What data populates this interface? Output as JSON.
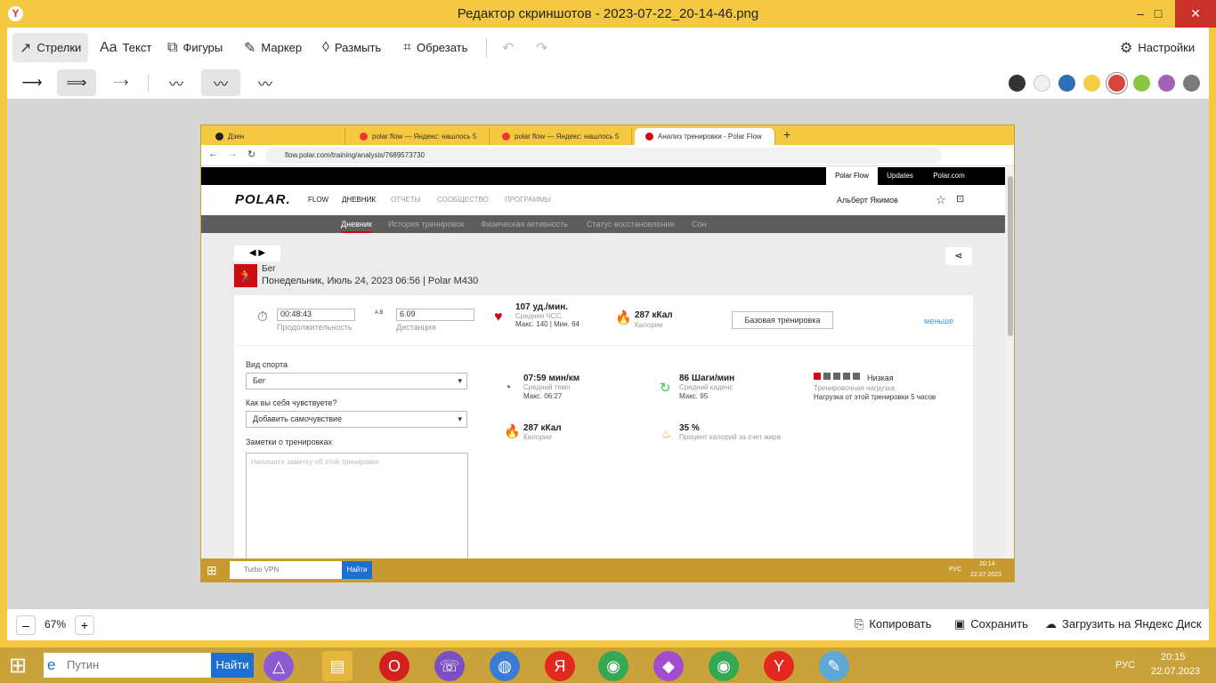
{
  "window": {
    "title": "Редактор скриншотов - 2023-07-22_20-14-46.png",
    "minimize": "–",
    "maximize": "□",
    "close": "✕"
  },
  "toolbar": {
    "arrows": "Стрелки",
    "text": "Текст",
    "shapes": "Фигуры",
    "marker": "Маркер",
    "blur": "Размыть",
    "crop": "Обрезать",
    "settings": "Настройки"
  },
  "colors": [
    "#333333",
    "#f0f0f0",
    "#2f6fb5",
    "#f5cc42",
    "#d9453b",
    "#8cc63f",
    "#a462b7",
    "#7a7a7a"
  ],
  "screenshot": {
    "tabs": [
      "Дзен",
      "polar flow — Яндекс: нашлось 5",
      "polar flow — Яндекс: нашлось 5",
      "Анализ тренировки - Polar Flow"
    ],
    "url": "flow.polar.com/training/analysis/7689573730",
    "top_links": [
      "Polar Flow",
      "Updates",
      "Polar.com"
    ],
    "logo": "POLAR.",
    "flow": "FLOW",
    "main_nav": [
      "ДНЕВНИК",
      "ОТЧЕТЫ",
      "СООБЩЕСТВО",
      "ПРОГРАММЫ"
    ],
    "user": "Альберт Якимов",
    "sub_nav": [
      "Дневник",
      "История тренировок",
      "Физическая активность",
      "Статус восстановления",
      "Сон"
    ],
    "sport": "Бег",
    "date_device": "Понедельник, Июль 24, 2023 06:56 | Polar M430",
    "duration_value": "00:48:43",
    "duration_label": "Продолжительность",
    "distance_value": "6.09",
    "distance_label": "Дистанция",
    "ab": "A B",
    "hr_value": "107 уд./мин.",
    "hr_label": "Средняя ЧСС",
    "hr_minmax": "Макс. 140 | Мин. 64",
    "cal_value": "287 кКал",
    "cal_label": "Калории",
    "base_training": "Базовая тренировка",
    "less": "меньше",
    "sport_label": "Вид спорта",
    "sport_select": "Бег",
    "feel_label": "Как вы себя чувствуете?",
    "feel_select": "Добавить самочувствие",
    "notes_label": "Заметки о тренировках",
    "notes_placeholder": "Напишите заметку об этой тренировке",
    "pace_value": "07:59 мин/км",
    "pace_label": "Средний темп",
    "pace_max": "Макс. 06:27",
    "cadence_value": "86 Шаги/мин",
    "cadence_label": "Средний каденс",
    "cadence_max": "Макс. 95",
    "load_level": "Низкая",
    "load_label": "Тренировочная нагрузка",
    "load_desc": "Нагрузка от этой тренировки 5 часов",
    "cal2_value": "287 кКал",
    "cal2_label": "Калории",
    "fat_value": "35 %",
    "fat_label": "Процент калорий за счет жира",
    "task_search": "Turbo VPN",
    "task_find": "Найти",
    "task_lang": "РУС",
    "task_time": "20:14",
    "task_date": "22.07.2023"
  },
  "bottom": {
    "minus": "–",
    "zoom": "67%",
    "plus": "+",
    "copy": "Копировать",
    "save": "Сохранить",
    "upload": "Загрузить на Яндекс Диск"
  },
  "taskbar": {
    "search_placeholder": "Путин",
    "find": "Найти",
    "lang": "РУС",
    "time": "20:15",
    "date": "22.07.2023"
  }
}
